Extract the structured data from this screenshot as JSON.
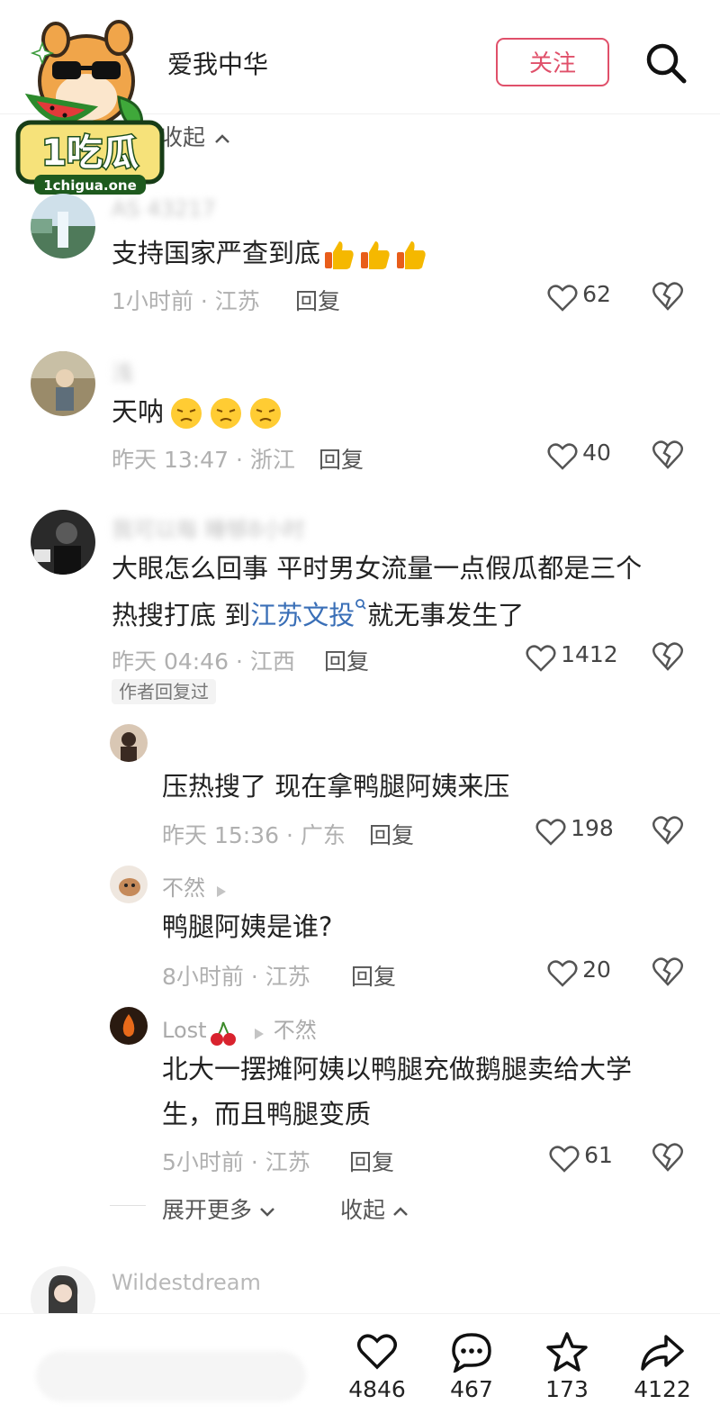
{
  "header": {
    "title": "爱我中华",
    "follow_label": "关注"
  },
  "logo": {
    "brand_text": "1吃瓜",
    "domain_text": "1chigua.one"
  },
  "collapse_top": "收起",
  "comments": [
    {
      "username": "AS 43217",
      "text": "支持国家严查到底",
      "emoji": [
        "thumbs-up",
        "thumbs-up",
        "thumbs-up"
      ],
      "time": "1小时前 · 江苏",
      "reply": "回复",
      "likes": "62"
    },
    {
      "username": "浅",
      "text": "天呐",
      "emoji": [
        "annoyed-face",
        "annoyed-face",
        "annoyed-face"
      ],
      "time": "昨天 13:47 · 浙江",
      "reply": "回复",
      "likes": "40"
    },
    {
      "username": "我可以每  睡够8小时",
      "text_line1": "大眼怎么回事 平时男女流量一点假瓜都是三个",
      "text_line2_pre": "热搜打底 到",
      "text_line2_link": "江苏文投",
      "text_line2_post": "就无事发生了",
      "time": "昨天 04:46 · 江西",
      "reply": "回复",
      "likes": "1412",
      "author_tag": "作者回复过",
      "replies": [
        {
          "username": "",
          "text": "压热搜了 现在拿鸭腿阿姨来压",
          "time": "昨天 15:36 · 广东",
          "reply": "回复",
          "likes": "198"
        },
        {
          "username": "不然",
          "text": "鸭腿阿姨是谁?",
          "time": "8小时前 · 江苏",
          "reply": "回复",
          "likes": "20"
        },
        {
          "username": "Lost",
          "reply_to": "不然",
          "text_line1": "北大一摆摊阿姨以鸭腿充做鹅腿卖给大学",
          "text_line2": "生，而且鸭腿变质",
          "time": "5小时前 · 江苏",
          "reply": "回复",
          "likes": "61"
        }
      ],
      "expand_more": "展开更多",
      "collapse": "收起"
    },
    {
      "username": "Wildestdream"
    }
  ],
  "bottom_bar": {
    "like_count": "4846",
    "comment_count": "467",
    "favorite_count": "173",
    "share_count": "4122"
  },
  "colors": {
    "accent": "#e0506a",
    "link": "#3a6fb7",
    "meta": "#b0b0b0"
  }
}
